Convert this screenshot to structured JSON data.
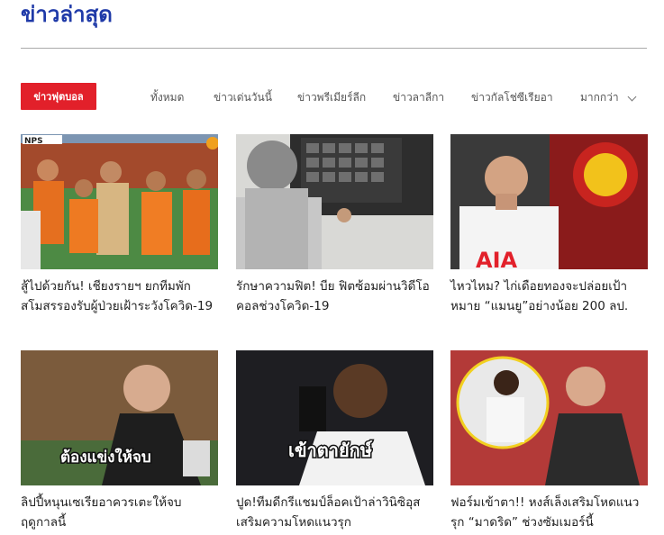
{
  "page_title": "ข่าวล่าสุด",
  "tabs": {
    "active": "ข่าวฟุตบอล",
    "items": [
      "ทั้งหมด",
      "ข่าวเด่นวันนี้",
      "ข่าวพรีเมียร์ลีก",
      "ข่าวลาลีกา",
      "ข่าวกัลโช่ซีเรียอา"
    ],
    "more": "มากกว่า"
  },
  "articles": [
    {
      "headline": "สู้ไปด้วยกัน! เชียงรายฯ ยกทีมพักสโมสรรองรับผู้ป่วยเฝ้าระวังโควิด-19",
      "image_badge": "NPS"
    },
    {
      "headline": "รักษาความฟิต! บีย ฟิตซ้อมผ่านวิดีโอคอลช่วงโควิด-19"
    },
    {
      "headline": "ไหวไหม? ไก่เดือยทองจะปล่อยเป้าหมาย “แมนยู”อย่างน้อย 200 ลป.",
      "image_text": "AIA"
    },
    {
      "headline": "ลิปปี้หนุนเซเรียอาควรเตะให้จบฤดูกาลนี้",
      "image_caption": "ต้องแข่งให้จบ"
    },
    {
      "headline": "ปูด!ทีมดีกรีแชมป์ล็อคเป้าล่าวินิซิอุสเสริมความโหดแนวรุก",
      "image_caption": "เข้าตายักษ์"
    },
    {
      "headline": "ฟอร์มเข้าตา!! หงส์เล็งเสริมโหดแนวรุก “มาดริด” ช่วงซัมเมอร์นี้"
    }
  ],
  "colors": {
    "title": "#1f3aa8",
    "accent": "#e2202a"
  }
}
